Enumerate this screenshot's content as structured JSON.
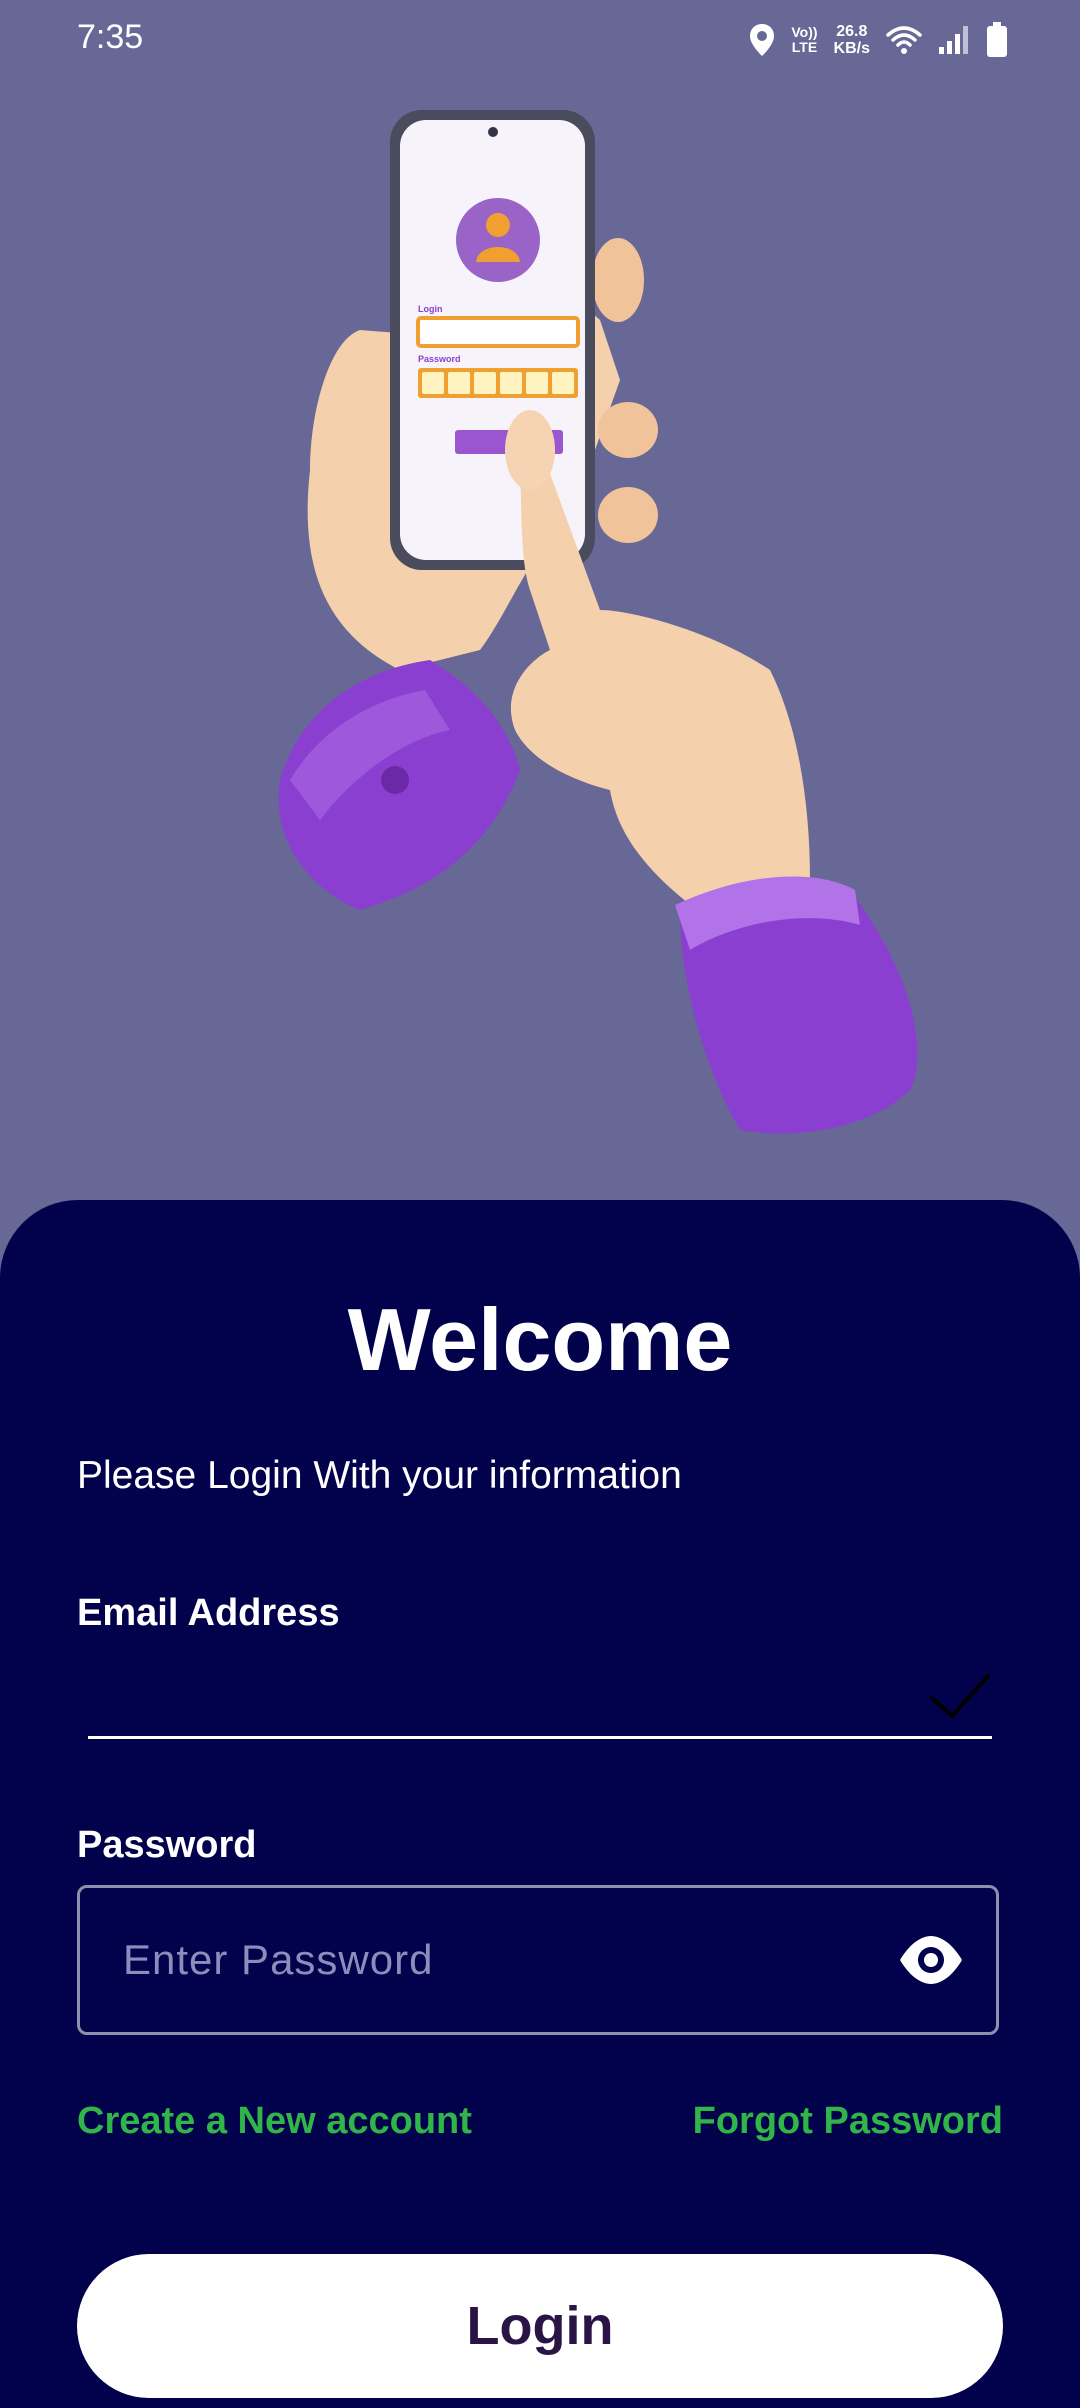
{
  "status_bar": {
    "time": "7:35",
    "volte_top": "Vo))",
    "volte_bottom": "LTE",
    "speed_value": "26.8",
    "speed_unit": "KB/s",
    "icons": [
      "location-icon",
      "volte-icon",
      "wifi-icon",
      "signal-icon",
      "battery-icon"
    ]
  },
  "hero": {
    "image": "hands-holding-phone-login-illustration",
    "phone_login_label": "Login",
    "phone_password_label": "Password"
  },
  "form": {
    "title": "Welcome",
    "subtitle": "Please Login With your information",
    "email_label": "Email Address",
    "email_value": "",
    "password_label": "Password",
    "password_placeholder": "Enter Password",
    "create_account": "Create a New account",
    "forgot_password": "Forgot Password",
    "login_button": "Login"
  },
  "colors": {
    "background": "#676896",
    "sheet": "#02024c",
    "link": "#2fb548",
    "button_text": "#2a1446",
    "accent_purple": "#8a3fd0"
  }
}
